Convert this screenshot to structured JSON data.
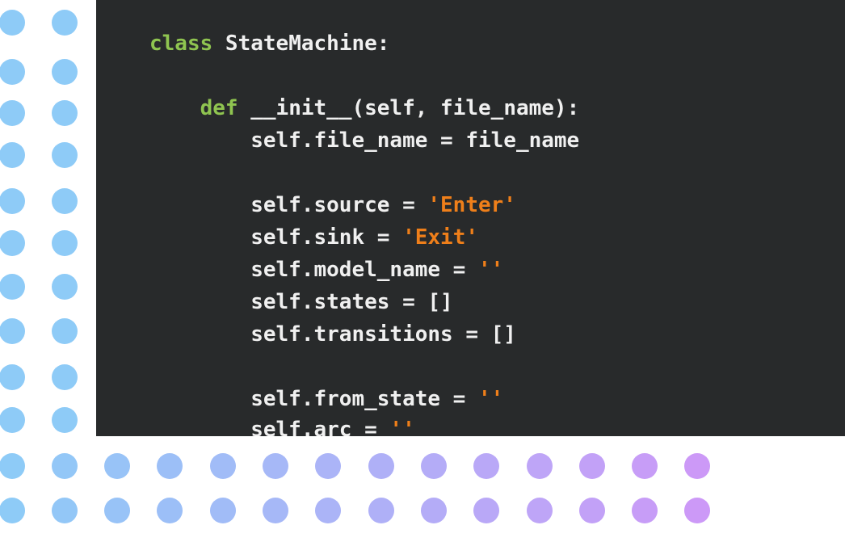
{
  "code_lines": [
    [
      {
        "text": "class",
        "style": "keyword"
      },
      {
        "text": " StateMachine:",
        "style": "plain"
      }
    ],
    [],
    [
      {
        "text": "    "
      },
      {
        "text": "def",
        "style": "keyword"
      },
      {
        "text": " __init__(self, file_name):",
        "style": "plain"
      }
    ],
    [
      {
        "text": "        self.file_name = file_name",
        "style": "plain"
      }
    ],
    [],
    [
      {
        "text": "        self.source = ",
        "style": "plain"
      },
      {
        "text": "'Enter'",
        "style": "string"
      }
    ],
    [
      {
        "text": "        self.sink = ",
        "style": "plain"
      },
      {
        "text": "'Exit'",
        "style": "string"
      }
    ],
    [
      {
        "text": "        self.model_name = ",
        "style": "plain"
      },
      {
        "text": "''",
        "style": "string"
      }
    ],
    [
      {
        "text": "        self.states = []",
        "style": "plain"
      }
    ],
    [
      {
        "text": "        self.transitions = []",
        "style": "plain"
      }
    ],
    [],
    [
      {
        "text": "        self.from_state = ",
        "style": "plain"
      },
      {
        "text": "''",
        "style": "string"
      }
    ],
    [
      {
        "text": "        self.arc = ",
        "style": "plain"
      },
      {
        "text": "''",
        "style": "string"
      }
    ]
  ],
  "colors": {
    "code_background": "#282a2b",
    "plain_text": "#f0f0f0",
    "keyword": "#8fc450",
    "string": "#ef7f1a",
    "dot_gradient_start": "#8ecbf7",
    "dot_gradient_end": "#cc99f7"
  }
}
